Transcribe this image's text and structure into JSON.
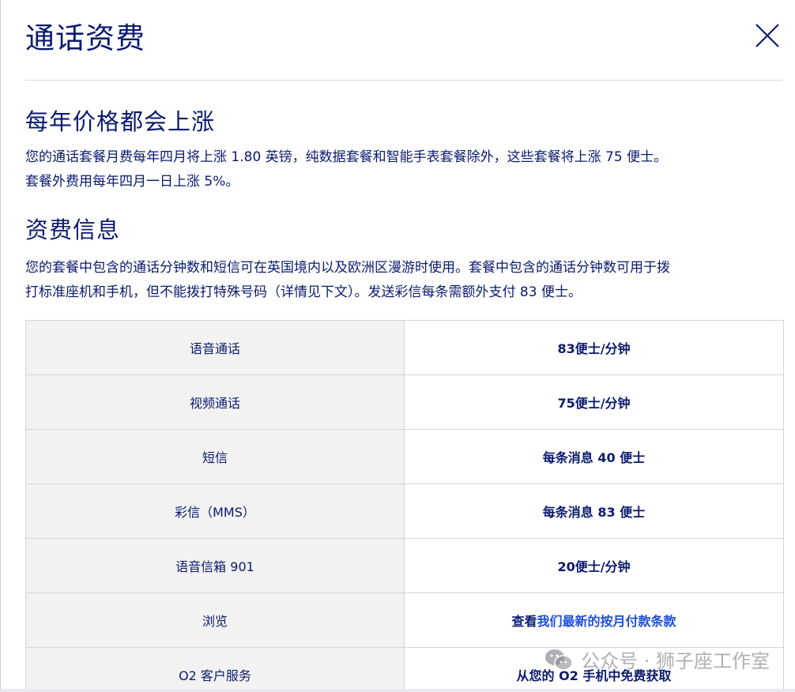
{
  "dialog": {
    "title": "通话资费",
    "close_icon": "close-icon"
  },
  "section1": {
    "heading": "每年价格都会上涨",
    "paragraph_line1": "您的通话套餐月费每年四月将上涨 1.80 英镑，纯数据套餐和智能手表套餐除外，这些套餐将上涨 75 便士。",
    "paragraph_line2": "套餐外费用每年四月一日上涨 5%。"
  },
  "section2": {
    "heading": "资费信息",
    "paragraph_line1": "您的套餐中包含的通话分钟数和短信可在英国境内以及欧洲区漫游时使用。套餐中包含的通话分钟数可用于拨",
    "paragraph_line2": "打标准座机和手机，但不能拨打特殊号码（详情见下文）。发送彩信每条需额外支付 83 便士。"
  },
  "rates": [
    {
      "label": "语音通话",
      "value": "83便士/分钟"
    },
    {
      "label": "视频通话",
      "value": "75便士/分钟"
    },
    {
      "label": "短信",
      "value": "每条消息 40 便士"
    },
    {
      "label": "彩信（MMS）",
      "value": "每条消息 83 便士"
    },
    {
      "label": "语音信箱 901",
      "value": "20便士/分钟"
    },
    {
      "label": "浏览",
      "value_prefix": "查看",
      "value_link": "我们最新的按月付款条款"
    },
    {
      "label": "O2 客户服务",
      "value": "从您的 O2 手机中免费获取"
    }
  ],
  "watermark": {
    "text": "公众号 · 狮子座工作室"
  },
  "colors": {
    "text": "#0a1a6e",
    "link": "#1f4fd8",
    "label_cell_bg": "#f2f2f2",
    "border": "#d3d5dc"
  }
}
